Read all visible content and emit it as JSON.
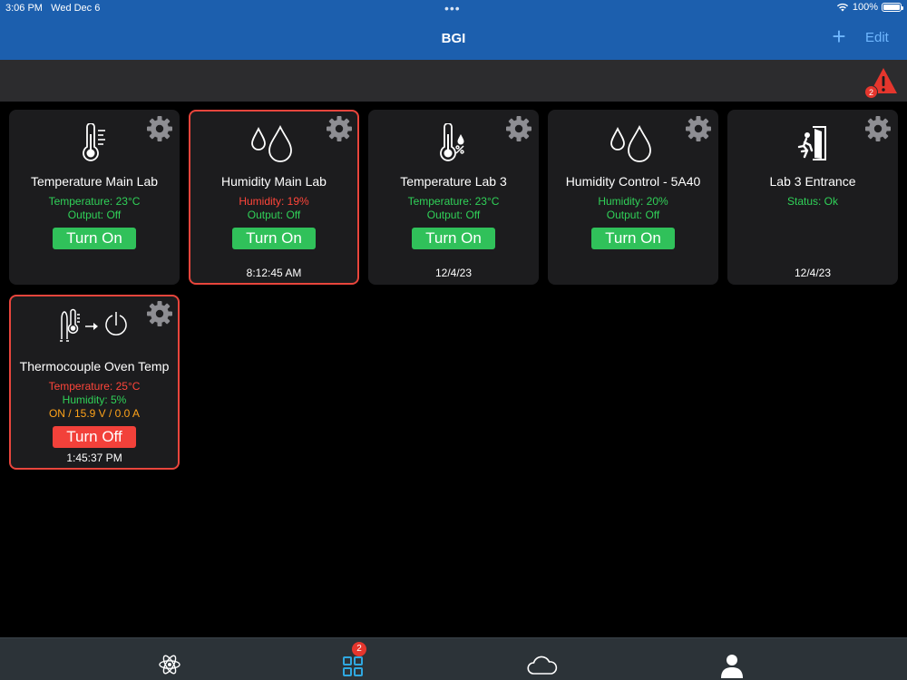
{
  "status_bar": {
    "time": "3:06 PM",
    "date": "Wed Dec 6",
    "battery": "100%"
  },
  "nav": {
    "title": "BGI",
    "add_label": "+",
    "edit_label": "Edit"
  },
  "alerts": {
    "count": "2",
    "icon": "warning-triangle-icon",
    "color": "#e5362d"
  },
  "colors": {
    "nav_bg": "#1c5fae",
    "card_bg": "#1c1c1e",
    "ok_green": "#30d158",
    "alarm_red": "#ff453a",
    "warn_orange": "#ffa31a",
    "link_blue": "#6fb7ff"
  },
  "devices": [
    {
      "name": "Temperature Main Lab",
      "icon": "thermometer-icon",
      "line1": "Temperature: 23°C",
      "line2": "Output: Off",
      "action": "Turn On",
      "stamp": ""
    },
    {
      "name": "Humidity Main Lab",
      "icon": "water-drops-icon",
      "line1": "Humidity: 19%",
      "line2": "Output: Off",
      "action": "Turn On",
      "stamp": "8:12:45 AM"
    },
    {
      "name": "Temperature Lab 3",
      "icon": "thermometer-humidity-icon",
      "line1": "Temperature: 23°C",
      "line2": "Output: Off",
      "action": "Turn On",
      "stamp": "12/4/23"
    },
    {
      "name": "Humidity Control - 5A40",
      "icon": "water-drops-icon",
      "line1": "Humidity: 20%",
      "line2": "Output: Off",
      "action": "Turn On",
      "stamp": ""
    },
    {
      "name": "Lab 3 Entrance",
      "icon": "door-exit-icon",
      "line1": "Status: Ok",
      "stamp": "12/4/23"
    },
    {
      "name": "Thermocouple Oven Temp",
      "icon": "thermocouple-power-icon",
      "line1": "Temperature: 25°C",
      "line2": "Humidity: 5%",
      "line3": "ON / 15.9 V / 0.0 A",
      "action": "Turn Off",
      "stamp": "1:45:37 PM"
    }
  ],
  "tabs": [
    {
      "icon": "atom-icon",
      "label": ""
    },
    {
      "icon": "grid-icon",
      "badge": "2"
    },
    {
      "icon": "cloud-icon"
    },
    {
      "icon": "person-icon"
    }
  ]
}
